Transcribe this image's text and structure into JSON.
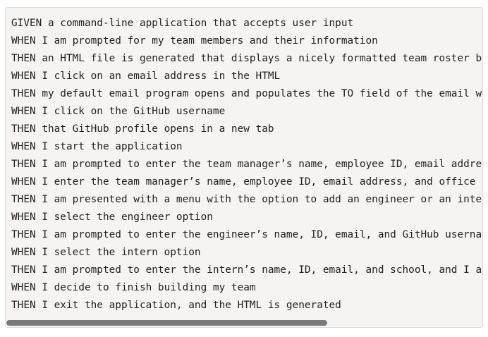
{
  "code": {
    "lines": [
      "GIVEN a command-line application that accepts user input",
      "WHEN I am prompted for my team members and their information",
      "THEN an HTML file is generated that displays a nicely formatted team roster based on user input",
      "WHEN I click on an email address in the HTML",
      "THEN my default email program opens and populates the TO field of the email with the address",
      "WHEN I click on the GitHub username",
      "THEN that GitHub profile opens in a new tab",
      "WHEN I start the application",
      "THEN I am prompted to enter the team manager’s name, employee ID, email address, and office number",
      "WHEN I enter the team manager’s name, employee ID, email address, and office number",
      "THEN I am presented with a menu with the option to add an engineer or an intern or to finish building my team",
      "WHEN I select the engineer option",
      "THEN I am prompted to enter the engineer’s name, ID, email, and GitHub username, and I am taken back to the menu",
      "WHEN I select the intern option",
      "THEN I am prompted to enter the intern’s name, ID, email, and school, and I am taken back to the menu",
      "WHEN I decide to finish building my team",
      "THEN I exit the application, and the HTML is generated"
    ]
  }
}
